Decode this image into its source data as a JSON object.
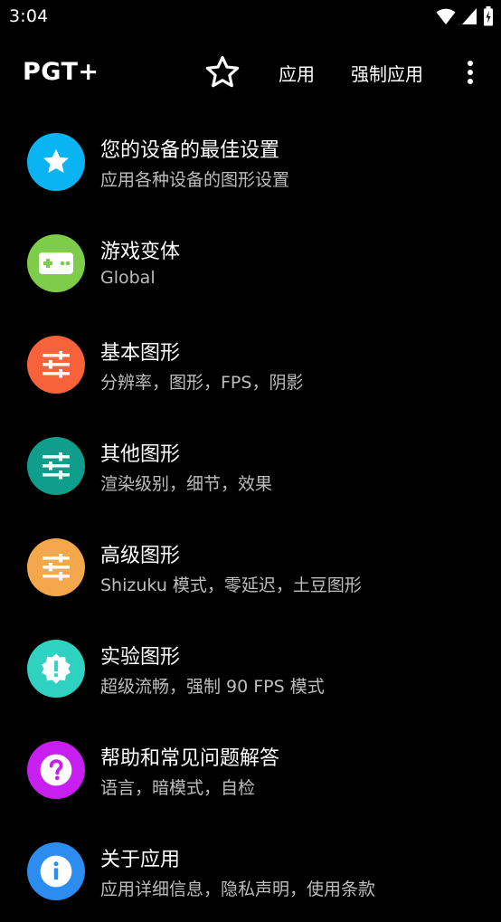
{
  "status_bar": {
    "time": "3:04",
    "icons": [
      "wifi-icon",
      "signal-icon",
      "battery-icon"
    ]
  },
  "app_bar": {
    "title": "PGT+",
    "star_icon": "star-outline-icon",
    "apply_label": "应用",
    "force_apply_label": "强制应用",
    "more_icon": "more-vert-icon"
  },
  "menu": {
    "items": [
      {
        "title": "您的设备的最佳设置",
        "subtitle": "应用各种设备的图形设置",
        "icon": "star-icon",
        "color": "#0ab4f2"
      },
      {
        "title": "游戏变体",
        "subtitle": "Global",
        "icon": "gamepad-icon",
        "color": "#7dcd4a"
      },
      {
        "title": "基本图形",
        "subtitle": "分辨率，图形，FPS，阴影",
        "icon": "sliders-icon",
        "color": "#f7623a"
      },
      {
        "title": "其他图形",
        "subtitle": "渲染级别，细节，效果",
        "icon": "sliders-icon",
        "color": "#0f9e8c"
      },
      {
        "title": "高级图形",
        "subtitle": "Shizuku 模式，零延迟，土豆图形",
        "icon": "sliders-icon",
        "color": "#f4a84b"
      },
      {
        "title": "实验图形",
        "subtitle": "超级流畅，强制 90 FPS 模式",
        "icon": "alert-badge-icon",
        "color": "#2fd1c1"
      },
      {
        "title": "帮助和常见问题解答",
        "subtitle": "语言，暗模式，自检",
        "icon": "help-icon",
        "color": "#c71ff0"
      },
      {
        "title": "关于应用",
        "subtitle": "应用详细信息，隐私声明，使用条款",
        "icon": "info-icon",
        "color": "#2d8cf0"
      }
    ]
  }
}
